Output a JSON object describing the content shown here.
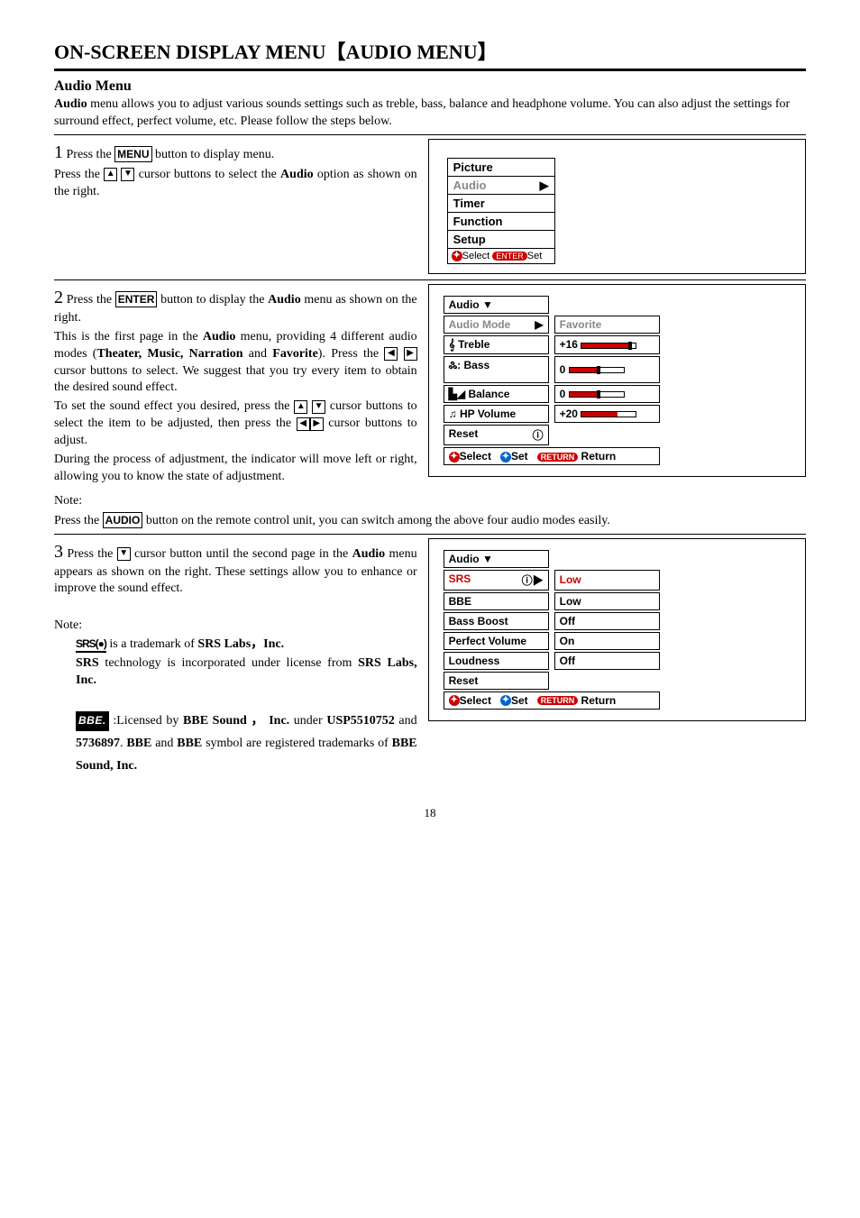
{
  "title_prefix": "ON-SCREEN DISPLAY MENU",
  "title_bracket": "【AUDIO MENU】",
  "section_heading": "Audio Menu",
  "intro_1": "Audio",
  "intro_2": " menu allows you to adjust various sounds settings such as treble, bass, balance and headphone volume. You can also adjust the settings for surround effect, perfect volume, etc. Please follow the steps below.",
  "s1": {
    "a": " Press the ",
    "btn1": "MENU",
    "b": " button to display menu.",
    "c": "Press the ",
    "d": " cursor buttons to select the ",
    "e": "Audio",
    "f": " option as shown on the right."
  },
  "menu1": {
    "i0": "Picture",
    "i1": "Audio",
    "i2": "Timer",
    "i3": "Function",
    "i4": "Setup",
    "foot_sel": "Select",
    "foot_ent": "ENTER",
    "foot_set": "Set"
  },
  "s2": {
    "a": "  Press the ",
    "btn": "ENTER",
    "b": " button to display the ",
    "c": "Audio",
    "d": " menu as shown on the right.",
    "p1a": "This is the first page in the ",
    "p1b": "Audio",
    "p1c": " menu, providing 4 different audio modes (",
    "p1d": "Theater, Music, Narration",
    "p1e": " and ",
    "p1f": "Favorite",
    "p1g": "). Press the ",
    "p1h": " cursor buttons to select. We suggest that you try every item to obtain the desired sound effect.",
    "p2a": "To set the sound effect you desired, press the ",
    "p2b": " cursor buttons to select the item to be adjusted, then press the ",
    "p2c": " cursor buttons to adjust.",
    "p3": "During the process of adjustment, the indicator will move left or right, allowing you to know the state of adjustment."
  },
  "menu2": {
    "head": "Audio",
    "r0l": "Audio Mode",
    "r0r": "Favorite",
    "r1l": "Treble",
    "r1r": "+16",
    "r2l": "Bass",
    "r2r": "0",
    "r3l": "Balance",
    "r3r": "0",
    "r4l": "HP Volume",
    "r4r": "+20",
    "r5l": "Reset",
    "foot_sel": "Select",
    "foot_set": "Set",
    "foot_retpill": "RETURN",
    "foot_ret": "Return"
  },
  "note_label": "Note:",
  "note1a": "Press the ",
  "note1btn": "AUDIO",
  "note1b": " button on the remote control unit, you can switch among the above four audio modes easily.",
  "s3": {
    "a": "   Press the ",
    "b": " cursor button until the second page in the ",
    "c": "Audio",
    "d": " menu appears as shown on the right. These settings allow you to enhance or improve the sound effect."
  },
  "note2a": " is a trademark of ",
  "note2b": "SRS Labs，Inc.",
  "note2c": "SRS",
  "note2d": " technology is incorporated under license from ",
  "note2e": "SRS Labs, Inc.",
  "bbe_a": ":Licensed by ",
  "bbe_b": "BBE Sound ， Inc.",
  "bbe_c": " under ",
  "bbe_d": "USP5510752",
  "bbe_e": " and ",
  "bbe_f": "5736897",
  "bbe_g": ". ",
  "bbe_h": "BBE",
  "bbe_i": " and ",
  "bbe_j": "BBE",
  "bbe_k": " symbol are registered trademarks of ",
  "bbe_l": "BBE Sound, Inc.",
  "menu3": {
    "head": "Audio",
    "r0l": "SRS",
    "r0r": "Low",
    "r1l": "BBE",
    "r1r": "Low",
    "r2l": "Bass Boost",
    "r2r": "Off",
    "r3l": "Perfect Volume",
    "r3r": "On",
    "r4l": "Loudness",
    "r4r": "Off",
    "r5l": "Reset",
    "foot_sel": "Select",
    "foot_set": "Set",
    "foot_retpill": "RETURN",
    "foot_ret": "Return"
  },
  "page_number": "18",
  "srs_logo_text": "SRS(●)",
  "bbe_logo_text": "BBE."
}
